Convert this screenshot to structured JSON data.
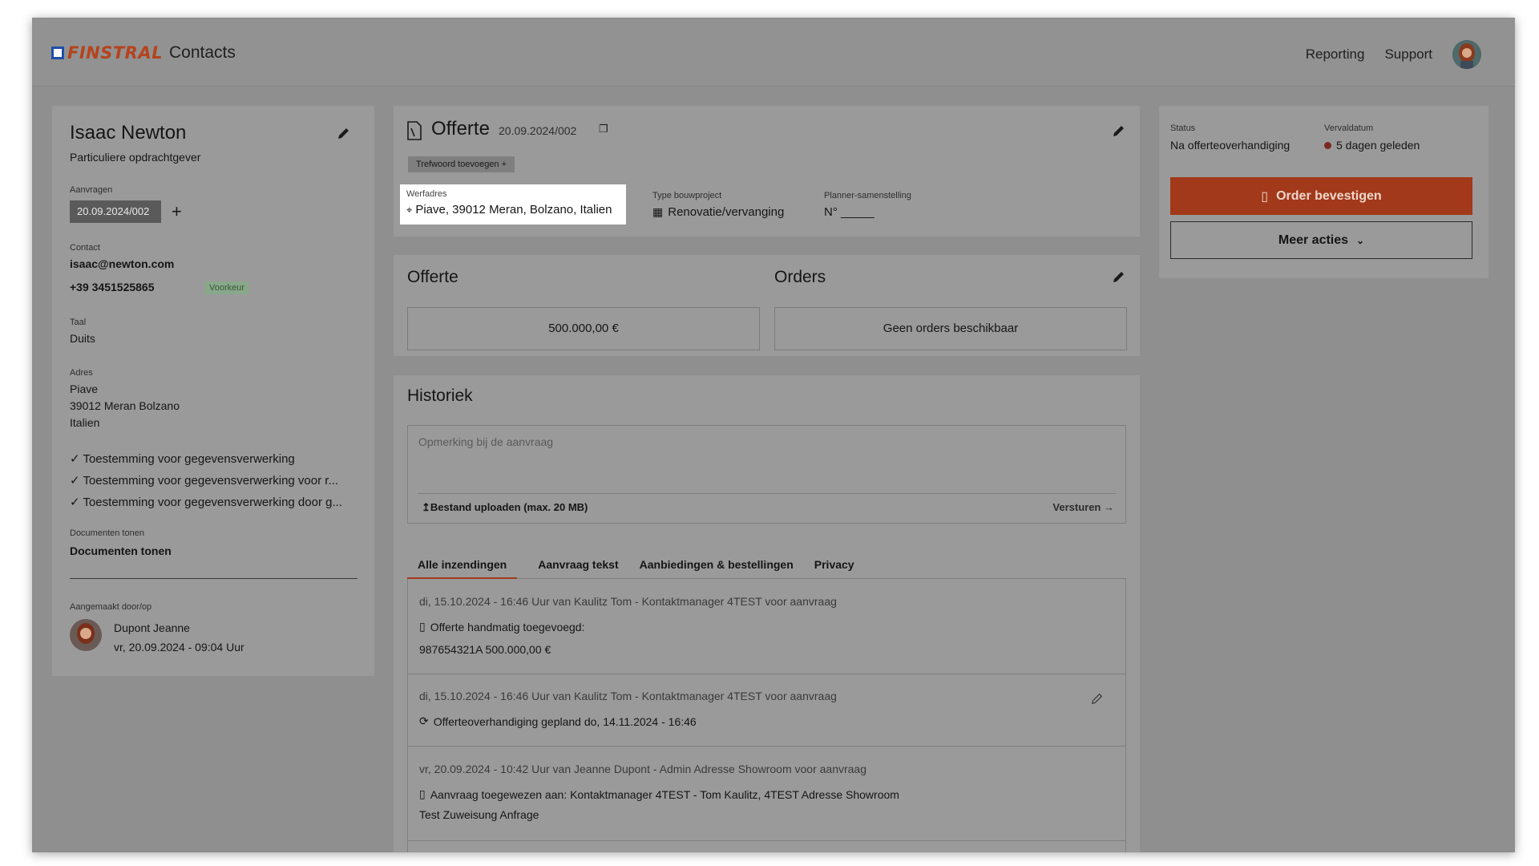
{
  "header": {
    "logo_text": "FINSTRAL",
    "app_name": "Contacts",
    "links": [
      "Reporting",
      "Support"
    ]
  },
  "contact": {
    "name": "Isaac Newton",
    "type": "Particuliere opdrachtgever",
    "requests_label": "Aanvragen",
    "request_chip": "20.09.2024/002",
    "contact_label": "Contact",
    "email": "isaac@newton.com",
    "phone": "+39 3451525865",
    "preferred_badge": "Voorkeur",
    "language_label": "Taal",
    "language": "Duits",
    "address_label": "Adres",
    "address_line1": "Piave",
    "address_line2": "39012 Meran Bolzano",
    "address_line3": "Italien",
    "consents": [
      "Toestemming voor gegevensverwerking",
      "Toestemming voor gegevensverwerking voor r...",
      "Toestemming voor gegevensverwerking door g..."
    ],
    "documents_label": "Documenten tonen",
    "documents_link": "Documenten tonen",
    "created_label": "Aangemaakt door/op",
    "created_by": "Dupont Jeanne",
    "created_at": "vr, 20.09.2024 - 09:04 Uur"
  },
  "quote": {
    "title": "Offerte",
    "number": "20.09.2024/002",
    "tag_button": "Trefwoord toevoegen +",
    "site_label": "Werfadres",
    "site_value": "Piave, 39012 Meran, Bolzano, Italien",
    "project_type_label": "Type bouwproject",
    "project_type_value": "Renovatie/vervanging",
    "planner_label": "Planner-samenstelling",
    "planner_value": "N° _____"
  },
  "summary": {
    "offer_title": "Offerte",
    "offer_value": "500.000,00 €",
    "orders_title": "Orders",
    "orders_value": "Geen orders beschikbaar"
  },
  "history": {
    "title": "Historiek",
    "comment_placeholder": "Opmerking bij de aanvraag",
    "upload_label": "Bestand uploaden (max. 20 MB)",
    "send_label": "Versturen",
    "tabs": [
      "Alle inzendingen",
      "Aanvraag tekst",
      "Aanbiedingen & bestellingen",
      "Privacy"
    ],
    "items": [
      {
        "meta": "di, 15.10.2024 - 16:46 Uur van Kaulitz Tom - Kontaktmanager 4TEST voor aanvraag",
        "line1": "Offerte handmatig toegevoegd:",
        "line2": "987654321A    500.000,00 €"
      },
      {
        "meta": "di, 15.10.2024 - 16:46 Uur van Kaulitz Tom - Kontaktmanager 4TEST voor aanvraag",
        "line1": "Offerteoverhandiging gepland do, 14.11.2024 - 16:46"
      },
      {
        "meta": "vr, 20.09.2024 - 10:42 Uur van Jeanne Dupont - Admin Adresse Showroom voor aanvraag",
        "line1": "Aanvraag toegewezen aan: Kontaktmanager 4TEST - Tom Kaulitz, 4TEST Adresse Showroom",
        "line2": "Test Zuweisung Anfrage"
      }
    ]
  },
  "status": {
    "status_label": "Status",
    "status_value": "Na offerteoverhandiging",
    "due_label": "Vervaldatum",
    "due_value": "5 dagen geleden",
    "confirm_button": "Order bevestigen",
    "more_button": "Meer acties"
  },
  "colors": {
    "accent": "#a2391a",
    "brand_blue": "#1f4fa8",
    "overlay": "#8f8f8f"
  }
}
